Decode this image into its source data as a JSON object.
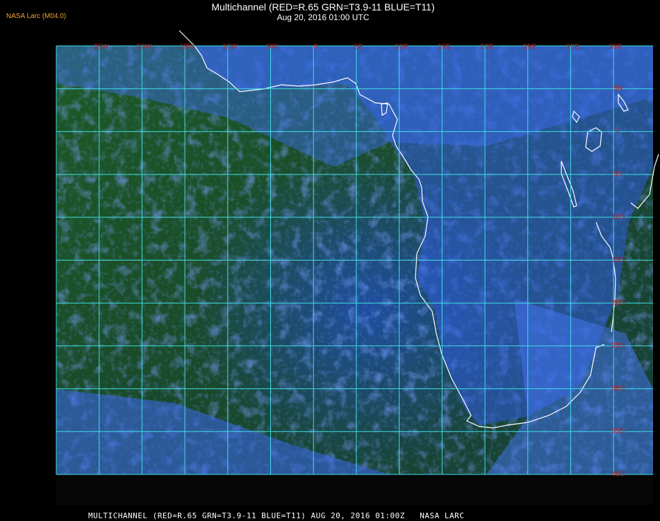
{
  "header": {
    "brand": "NASA Larc (M04.0)",
    "title": "Multichannel (RED=R.65 GRN=T3.9-11 BLUE=T11)",
    "datetime": "Aug 20, 2016 01:00 UTC"
  },
  "footer": {
    "text": "MULTICHANNEL (RED=R.65 GRN=T3.9-11 BLUE=T11) AUG 20, 2016 01:00Z   NASA LARC"
  },
  "map": {
    "longitude_labels": [
      "25W",
      "20W",
      "15W",
      "10W",
      "5W",
      "0",
      "5E",
      "10E",
      "15E",
      "20E",
      "25E",
      "30E",
      "35E"
    ],
    "latitude_labels": [
      "5N",
      "0",
      "5S",
      "10S",
      "15S",
      "20S",
      "25S",
      "30S",
      "35S",
      "40S"
    ],
    "colors": {
      "grid": "#40e0e8",
      "label": "#c02020",
      "coastline": "#ffffff",
      "ocean_clear": "#1a4a1c",
      "cloud_low": "#2a4ed0",
      "cloud_high": "#4a7cff"
    }
  }
}
